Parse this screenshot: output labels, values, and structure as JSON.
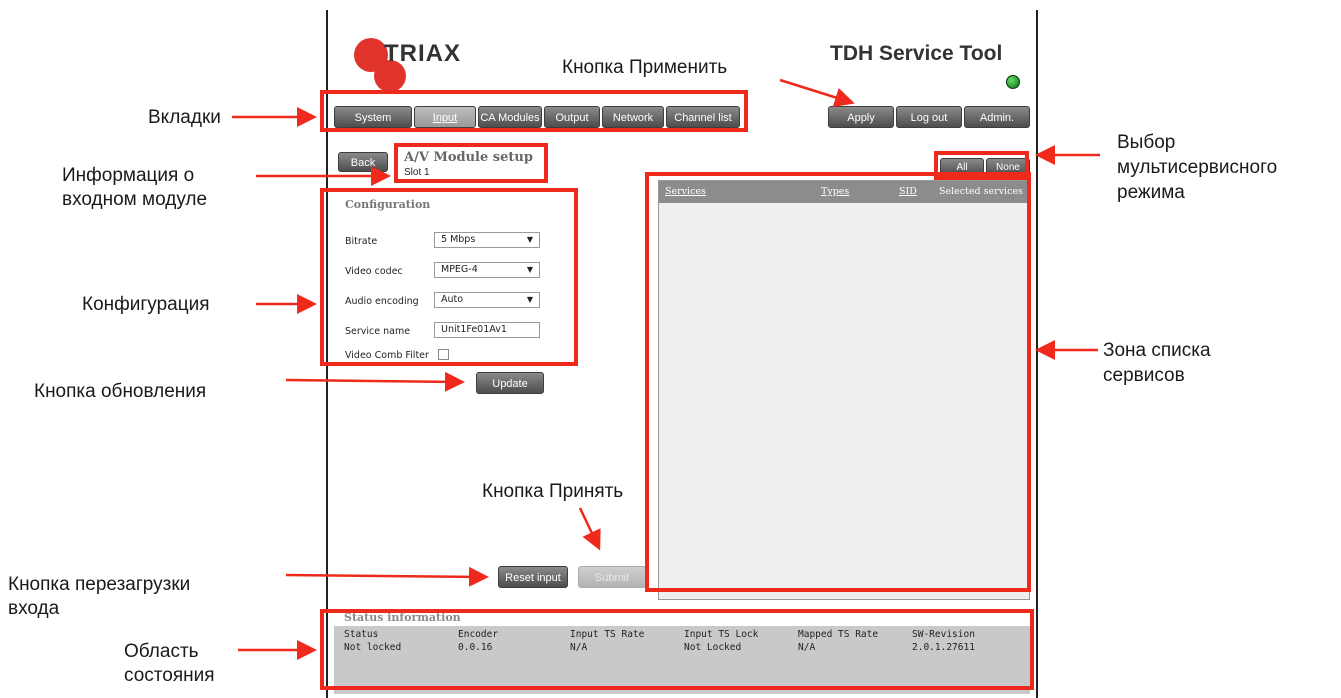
{
  "header": {
    "logo_text": "TRIAX",
    "app_title": "TDH Service Tool"
  },
  "tabs": [
    {
      "label": "System",
      "active": false
    },
    {
      "label": "Input",
      "active": true
    },
    {
      "label": "CA Modules",
      "active": false
    },
    {
      "label": "Output",
      "active": false
    },
    {
      "label": "Network",
      "active": false
    },
    {
      "label": "Channel list",
      "active": false
    }
  ],
  "top_buttons": {
    "apply": "Apply",
    "logout": "Log out",
    "admin": "Admin."
  },
  "module": {
    "back_label": "Back",
    "title": "A/V Module setup",
    "slot": "Slot 1"
  },
  "configuration": {
    "heading": "Configuration",
    "bitrate_label": "Bitrate",
    "bitrate_value": "5 Mbps",
    "video_codec_label": "Video codec",
    "video_codec_value": "MPEG-4",
    "audio_encoding_label": "Audio encoding",
    "audio_encoding_value": "Auto",
    "service_name_label": "Service name",
    "service_name_value": "Unit1Fe01Av1",
    "comb_filter_label": "Video Comb Filter",
    "comb_filter_checked": false
  },
  "buttons": {
    "update": "Update",
    "reset_input": "Reset input",
    "submit": "Submit",
    "all": "All",
    "none": "None"
  },
  "services": {
    "columns": [
      "Services",
      "Types",
      "SID",
      "Selected services"
    ],
    "rows": []
  },
  "status": {
    "title": "Status information",
    "headers": [
      "Status",
      "Encoder",
      "Input TS Rate",
      "Input TS Lock",
      "Mapped TS Rate",
      "SW-Revision"
    ],
    "values": [
      "Not locked",
      "0.0.16",
      "N/A",
      "Not Locked",
      "N/A",
      "2.0.1.27611"
    ]
  },
  "annotations": {
    "tabs": "Вкладки",
    "input_info": [
      "Информация о",
      "входном модуле"
    ],
    "configuration": "Конфигурация",
    "update_button": "Кнопка обновления",
    "reset_button": [
      "Кнопка перезагрузки",
      "входа"
    ],
    "status_area": [
      "Область",
      "состояния"
    ],
    "apply_button": "Кнопка Применить",
    "submit_button": "Кнопка Принять",
    "multiservice": [
      "Выбор",
      "мультисервисного",
      "режима"
    ],
    "service_list_zone": [
      "Зона списка",
      "сервисов"
    ]
  },
  "colors": {
    "annotation_red": "#ef2a1c",
    "logo_red": "#e0332c",
    "led_green": "#1f9b2a"
  }
}
